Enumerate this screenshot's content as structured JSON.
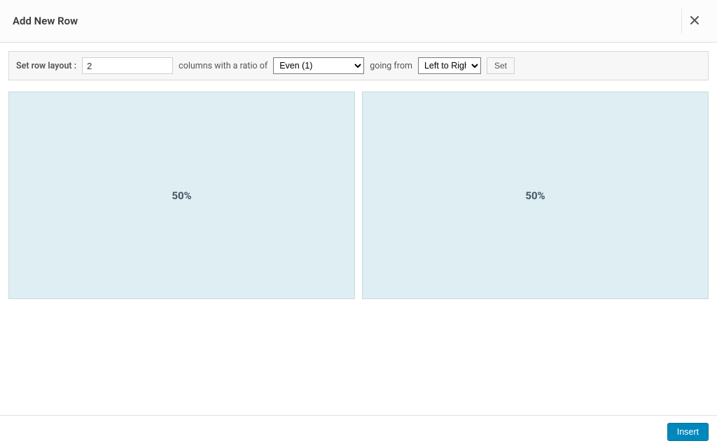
{
  "dialog": {
    "title": "Add New Row",
    "close_icon": "close"
  },
  "layout_bar": {
    "label": "Set row layout  :",
    "columns_value": "2",
    "mid_text": "columns with a ratio of",
    "ratio_value": "Even (1)",
    "going_text": "going from",
    "direction_value": "Left to Right",
    "set_label": "Set"
  },
  "preview": {
    "columns": [
      {
        "width_label": "50%"
      },
      {
        "width_label": "50%"
      }
    ]
  },
  "footer": {
    "insert_label": "Insert"
  }
}
